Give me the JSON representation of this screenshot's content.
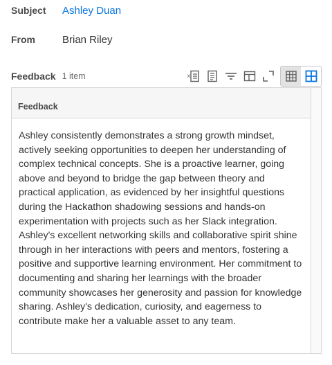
{
  "subject": {
    "label": "Subject",
    "value": "Ashley Duan"
  },
  "from": {
    "label": "From",
    "value": "Brian Riley"
  },
  "feedback_grid": {
    "title": "Feedback",
    "count": "1 item",
    "toolbar_icons": [
      "export-excel-icon",
      "export-pdf-icon",
      "filter-icon",
      "column-layout-icon",
      "fullscreen-icon",
      "table-view-icon",
      "grid-view-icon"
    ],
    "column_header": "Feedback",
    "rows": [
      {
        "feedback": "Ashley consistently demonstrates a strong growth mindset, actively seeking opportunities to deepen her understanding of complex technical concepts. She is a proactive learner, going above and beyond to bridge the gap between theory and practical application, as evidenced by her insightful questions during the Hackathon shadowing sessions and hands-on experimentation with projects such as her Slack integration. Ashley's excellent networking skills and collaborative spirit shine through in her interactions with peers and mentors, fostering a positive and supportive learning environment. Her commitment to documenting and sharing her learnings with the broader community showcases her generosity and passion for knowledge sharing. Ashley's dedication, curiosity, and eagerness to contribute make her a valuable asset to any team."
      }
    ]
  },
  "colors": {
    "link": "#0875e1",
    "active_toggle": "#0875e1"
  }
}
